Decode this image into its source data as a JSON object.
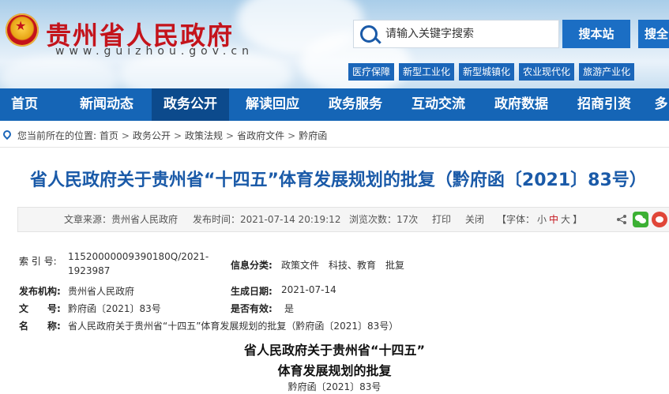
{
  "header": {
    "site_title": "贵州省人民政府",
    "site_url": "www.guizhou.gov.cn",
    "search_placeholder": "请输入关键字搜索",
    "search_site_label": "搜本站",
    "search_all_label": "搜全",
    "tags": [
      "医疗保障",
      "新型工业化",
      "新型城镇化",
      "农业现代化",
      "旅游产业化"
    ]
  },
  "nav": {
    "items": [
      "首页",
      "新闻动态",
      "政务公开",
      "解读回应",
      "政务服务",
      "互动交流",
      "政府数据",
      "招商引资",
      "多"
    ],
    "active": "政务公开"
  },
  "breadcrumb": {
    "prefix": "您当前所在的位置:",
    "items": [
      "首页",
      "政务公开",
      "政策法规",
      "省政府文件",
      "黔府函"
    ]
  },
  "article": {
    "title": "省人民政府关于贵州省“十四五”体育发展规划的批复（黔府函〔2021〕83号）"
  },
  "infobar": {
    "source": "文章来源：贵州省人民政府",
    "publish_time": "发布时间：2021-07-14 20:19:12",
    "views": "浏览次数：17次",
    "print": "打印",
    "close": "关闭",
    "font_prefix": "【字体：",
    "font_small": "小",
    "font_medium": "中",
    "font_large": "大",
    "font_suffix": "】"
  },
  "meta": {
    "index_label": "索 引 号:",
    "index_value_line1": "11520000009390180Q/2021-",
    "index_value_line2": "1923987",
    "category_label": "信息分类:",
    "category_value": "政策文件　科技、教育　批复",
    "agency_label": "发布机构:",
    "agency_value": "贵州省人民政府",
    "date_label": "生成日期:",
    "date_value": "2021-07-14",
    "docno_label": "文　　号:",
    "docno_value": "黔府函〔2021〕83号",
    "valid_label": "是否有效:",
    "valid_value": "是",
    "name_label": "名　　称:",
    "name_value": "省人民政府关于贵州省“十四五”体育发展规划的批复（黔府函〔2021〕83号）"
  },
  "doc": {
    "title_line1": "省人民政府关于贵州省“十四五”",
    "title_line2": "体育发展规划的批复",
    "number": "黔府函〔2021〕83号"
  }
}
